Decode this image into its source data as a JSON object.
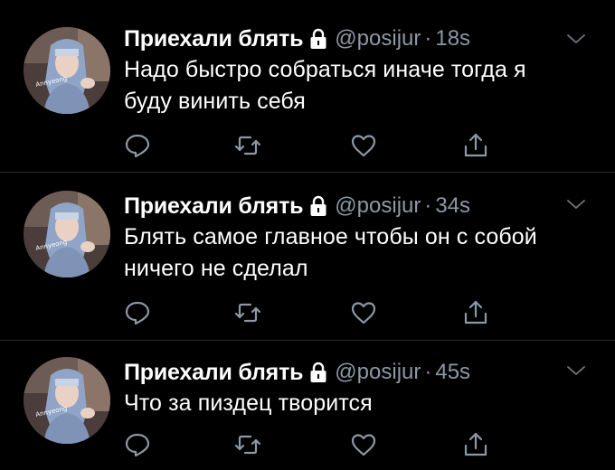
{
  "colors": {
    "background": "#000000",
    "text": "#ffffff",
    "secondary": "#8b98a5",
    "divider": "#2b2b2e"
  },
  "tweets": [
    {
      "display_name": "Приехали блять",
      "handle": "@posijur",
      "separator": "·",
      "time": "18s",
      "lines": [
        "Надо быстро собраться иначе тогда я",
        "буду винить себя"
      ],
      "avatar_watermark": "Annyeong"
    },
    {
      "display_name": "Приехали блять",
      "handle": "@posijur",
      "separator": "·",
      "time": "34s",
      "lines": [
        "Блять самое главное чтобы он с собой",
        "ничего не сделал"
      ],
      "avatar_watermark": "Annyeong"
    },
    {
      "display_name": "Приехали блять",
      "handle": "@posijur",
      "separator": "·",
      "time": "45s",
      "lines": [
        "Что за пиздец творится"
      ],
      "avatar_watermark": "Annyeong"
    }
  ],
  "icons": {
    "protected": "lock-icon",
    "menu": "chevron-down-icon",
    "reply": "reply-icon",
    "retweet": "retweet-icon",
    "like": "heart-icon",
    "share": "share-icon"
  }
}
